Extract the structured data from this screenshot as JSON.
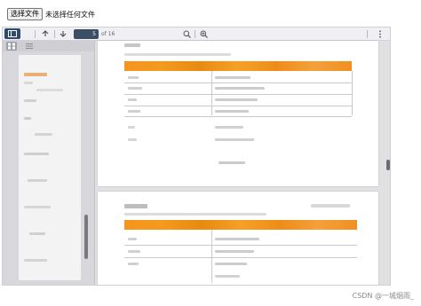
{
  "file_input": {
    "button_label": "选择文件",
    "status": "未选择任何文件"
  },
  "toolbar": {
    "sidebar_toggle_icon": "sidebar-toggle-icon",
    "prev_icon": "arrow-up-icon",
    "next_icon": "arrow-down-icon",
    "page_number": "5",
    "page_count": "of 16",
    "zoom_out_icon": "zoom-out-icon",
    "zoom_in_icon": "zoom-in-icon",
    "menu_icon": "more-vertical-icon"
  },
  "watermark": "CSDN @一城烟雨_",
  "colors": {
    "highlight_band": "#f7941d",
    "toolbar_bg": "#f0f0f4",
    "sidebar_toggle_bg": "#2f4a6e"
  }
}
